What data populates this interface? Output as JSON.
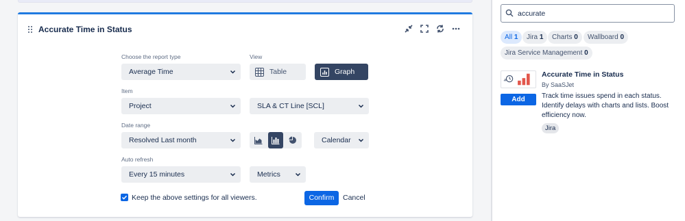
{
  "gadget": {
    "title": "Accurate Time in Status"
  },
  "form": {
    "report_type": {
      "label": "Choose the report type",
      "value": "Average Time"
    },
    "view": {
      "label": "View",
      "table_label": "Table",
      "graph_label": "Graph",
      "selected": "Graph"
    },
    "item": {
      "label": "Item",
      "value": "Project",
      "project_value": "SLA & CT Line [SCL]"
    },
    "date_range": {
      "label": "Date range",
      "value": "Resolved Last month",
      "calendar_value": "Calendar",
      "chart_type_selected": "bar-chart"
    },
    "auto_refresh": {
      "label": "Auto refresh",
      "value": "Every 15 minutes",
      "metrics_value": "Metrics"
    },
    "keep_settings": {
      "label": "Keep the above settings for all viewers.",
      "checked": true
    },
    "confirm_label": "Confirm",
    "cancel_label": "Cancel"
  },
  "search": {
    "value": "accurate"
  },
  "filters": [
    {
      "label": "All",
      "count": "1",
      "active": true
    },
    {
      "label": "Jira",
      "count": "1",
      "active": false
    },
    {
      "label": "Charts",
      "count": "0",
      "active": false
    },
    {
      "label": "Wallboard",
      "count": "0",
      "active": false
    },
    {
      "label": "Jira Service Management",
      "count": "0",
      "active": false
    }
  ],
  "result": {
    "title": "Accurate Time in Status",
    "vendor": "By SaaSJet",
    "add_label": "Add",
    "description": "Track time issues spend in each status. Identify delays with charts and lists. Boost efficiency now.",
    "tag": "Jira"
  },
  "colors": {
    "accent": "#1f7ae0",
    "primary_button": "#0c66e4",
    "selected_toggle": "#344563",
    "logo_bars": "#e2574c"
  }
}
